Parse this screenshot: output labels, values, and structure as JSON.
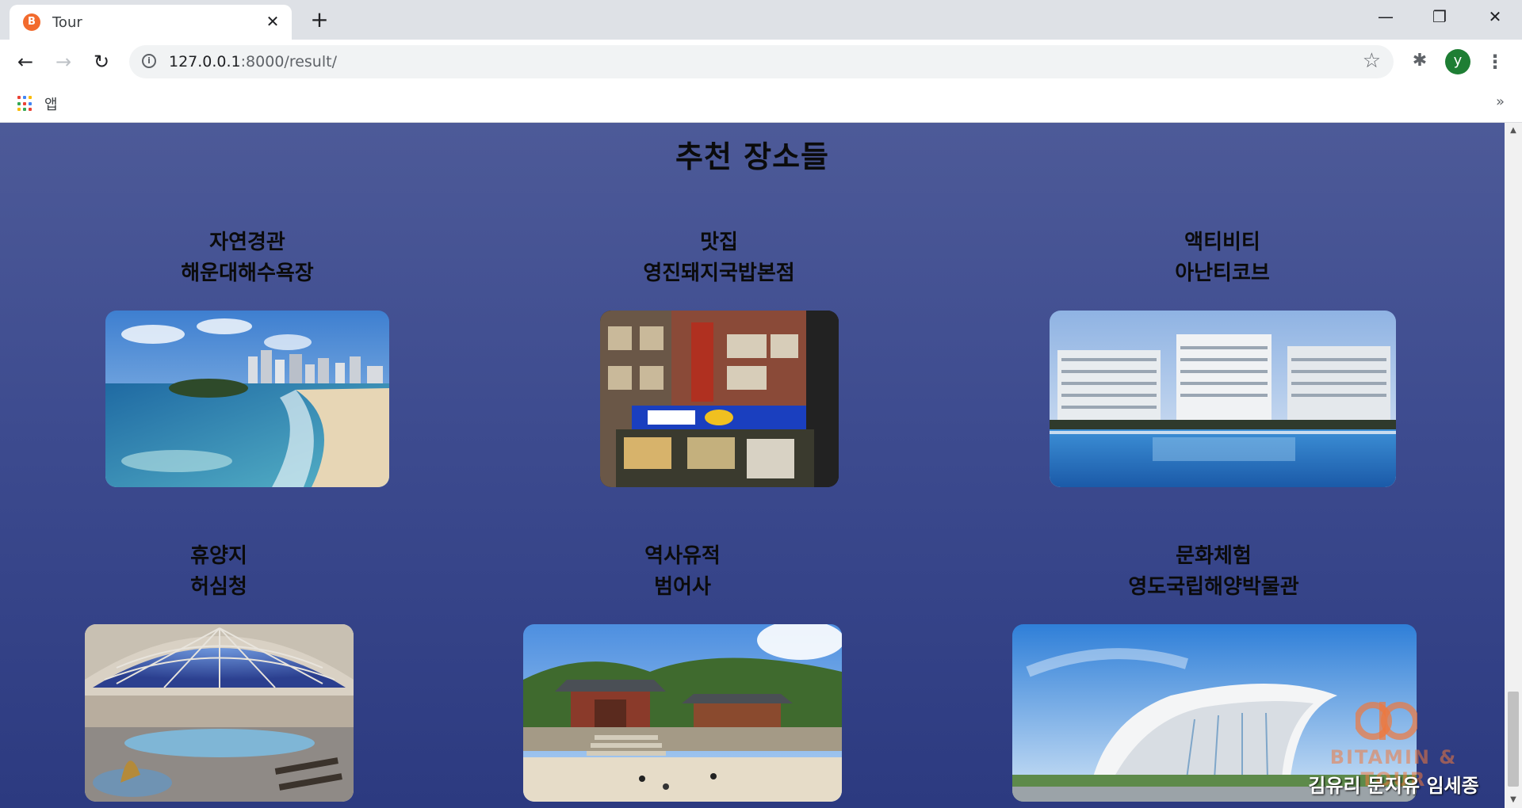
{
  "browser": {
    "tab_title": "Tour",
    "tab_close": "✕",
    "new_tab": "+",
    "url_host": "127.0.0.1",
    "url_rest": ":8000/result/",
    "avatar_letter": "y",
    "bookmarks_apps_label": "앱",
    "bookmarks_more": "»",
    "window": {
      "minimize": "—",
      "restore": "❐",
      "close": "✕"
    }
  },
  "page": {
    "title": "추천 장소들",
    "cards": [
      {
        "category": "자연경관",
        "place": "해운대해수욕장",
        "image": "beach-photo"
      },
      {
        "category": "맛집",
        "place": "영진돼지국밥본점",
        "image": "restaurant-photo"
      },
      {
        "category": "액티비티",
        "place": "아난티코브",
        "image": "resort-pool-photo"
      },
      {
        "category": "휴양지",
        "place": "허심청",
        "image": "spa-dome-photo"
      },
      {
        "category": "역사유적",
        "place": "범어사",
        "image": "temple-photo"
      },
      {
        "category": "문화체험",
        "place": "영도국립해양박물관",
        "image": "museum-photo"
      }
    ]
  },
  "watermark": {
    "logo": "BB",
    "brand": "BITAMIN & TOUR",
    "names": "김유리 문지유 임세종"
  },
  "colors": {
    "page_bg_top": "#4d5a98",
    "page_bg_bottom": "#2c3a80",
    "favicon": "#f26b2e",
    "avatar": "#1e7e34"
  }
}
